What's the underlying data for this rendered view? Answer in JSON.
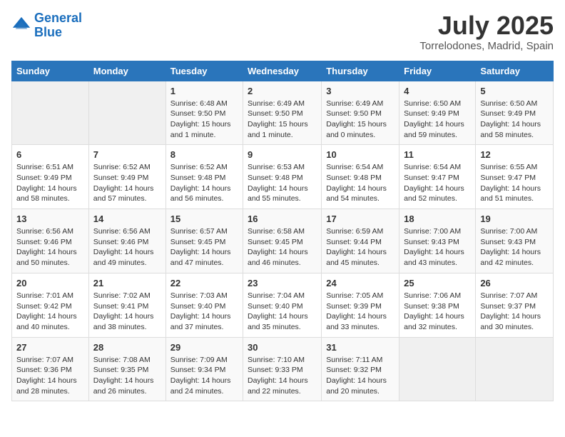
{
  "header": {
    "logo_line1": "General",
    "logo_line2": "Blue",
    "main_title": "July 2025",
    "subtitle": "Torrelodones, Madrid, Spain"
  },
  "calendar": {
    "days_of_week": [
      "Sunday",
      "Monday",
      "Tuesday",
      "Wednesday",
      "Thursday",
      "Friday",
      "Saturday"
    ],
    "weeks": [
      [
        {
          "day": "",
          "info": ""
        },
        {
          "day": "",
          "info": ""
        },
        {
          "day": "1",
          "info": "Sunrise: 6:48 AM\nSunset: 9:50 PM\nDaylight: 15 hours and 1 minute."
        },
        {
          "day": "2",
          "info": "Sunrise: 6:49 AM\nSunset: 9:50 PM\nDaylight: 15 hours and 1 minute."
        },
        {
          "day": "3",
          "info": "Sunrise: 6:49 AM\nSunset: 9:50 PM\nDaylight: 15 hours and 0 minutes."
        },
        {
          "day": "4",
          "info": "Sunrise: 6:50 AM\nSunset: 9:49 PM\nDaylight: 14 hours and 59 minutes."
        },
        {
          "day": "5",
          "info": "Sunrise: 6:50 AM\nSunset: 9:49 PM\nDaylight: 14 hours and 58 minutes."
        }
      ],
      [
        {
          "day": "6",
          "info": "Sunrise: 6:51 AM\nSunset: 9:49 PM\nDaylight: 14 hours and 58 minutes."
        },
        {
          "day": "7",
          "info": "Sunrise: 6:52 AM\nSunset: 9:49 PM\nDaylight: 14 hours and 57 minutes."
        },
        {
          "day": "8",
          "info": "Sunrise: 6:52 AM\nSunset: 9:48 PM\nDaylight: 14 hours and 56 minutes."
        },
        {
          "day": "9",
          "info": "Sunrise: 6:53 AM\nSunset: 9:48 PM\nDaylight: 14 hours and 55 minutes."
        },
        {
          "day": "10",
          "info": "Sunrise: 6:54 AM\nSunset: 9:48 PM\nDaylight: 14 hours and 54 minutes."
        },
        {
          "day": "11",
          "info": "Sunrise: 6:54 AM\nSunset: 9:47 PM\nDaylight: 14 hours and 52 minutes."
        },
        {
          "day": "12",
          "info": "Sunrise: 6:55 AM\nSunset: 9:47 PM\nDaylight: 14 hours and 51 minutes."
        }
      ],
      [
        {
          "day": "13",
          "info": "Sunrise: 6:56 AM\nSunset: 9:46 PM\nDaylight: 14 hours and 50 minutes."
        },
        {
          "day": "14",
          "info": "Sunrise: 6:56 AM\nSunset: 9:46 PM\nDaylight: 14 hours and 49 minutes."
        },
        {
          "day": "15",
          "info": "Sunrise: 6:57 AM\nSunset: 9:45 PM\nDaylight: 14 hours and 47 minutes."
        },
        {
          "day": "16",
          "info": "Sunrise: 6:58 AM\nSunset: 9:45 PM\nDaylight: 14 hours and 46 minutes."
        },
        {
          "day": "17",
          "info": "Sunrise: 6:59 AM\nSunset: 9:44 PM\nDaylight: 14 hours and 45 minutes."
        },
        {
          "day": "18",
          "info": "Sunrise: 7:00 AM\nSunset: 9:43 PM\nDaylight: 14 hours and 43 minutes."
        },
        {
          "day": "19",
          "info": "Sunrise: 7:00 AM\nSunset: 9:43 PM\nDaylight: 14 hours and 42 minutes."
        }
      ],
      [
        {
          "day": "20",
          "info": "Sunrise: 7:01 AM\nSunset: 9:42 PM\nDaylight: 14 hours and 40 minutes."
        },
        {
          "day": "21",
          "info": "Sunrise: 7:02 AM\nSunset: 9:41 PM\nDaylight: 14 hours and 38 minutes."
        },
        {
          "day": "22",
          "info": "Sunrise: 7:03 AM\nSunset: 9:40 PM\nDaylight: 14 hours and 37 minutes."
        },
        {
          "day": "23",
          "info": "Sunrise: 7:04 AM\nSunset: 9:40 PM\nDaylight: 14 hours and 35 minutes."
        },
        {
          "day": "24",
          "info": "Sunrise: 7:05 AM\nSunset: 9:39 PM\nDaylight: 14 hours and 33 minutes."
        },
        {
          "day": "25",
          "info": "Sunrise: 7:06 AM\nSunset: 9:38 PM\nDaylight: 14 hours and 32 minutes."
        },
        {
          "day": "26",
          "info": "Sunrise: 7:07 AM\nSunset: 9:37 PM\nDaylight: 14 hours and 30 minutes."
        }
      ],
      [
        {
          "day": "27",
          "info": "Sunrise: 7:07 AM\nSunset: 9:36 PM\nDaylight: 14 hours and 28 minutes."
        },
        {
          "day": "28",
          "info": "Sunrise: 7:08 AM\nSunset: 9:35 PM\nDaylight: 14 hours and 26 minutes."
        },
        {
          "day": "29",
          "info": "Sunrise: 7:09 AM\nSunset: 9:34 PM\nDaylight: 14 hours and 24 minutes."
        },
        {
          "day": "30",
          "info": "Sunrise: 7:10 AM\nSunset: 9:33 PM\nDaylight: 14 hours and 22 minutes."
        },
        {
          "day": "31",
          "info": "Sunrise: 7:11 AM\nSunset: 9:32 PM\nDaylight: 14 hours and 20 minutes."
        },
        {
          "day": "",
          "info": ""
        },
        {
          "day": "",
          "info": ""
        }
      ]
    ]
  }
}
